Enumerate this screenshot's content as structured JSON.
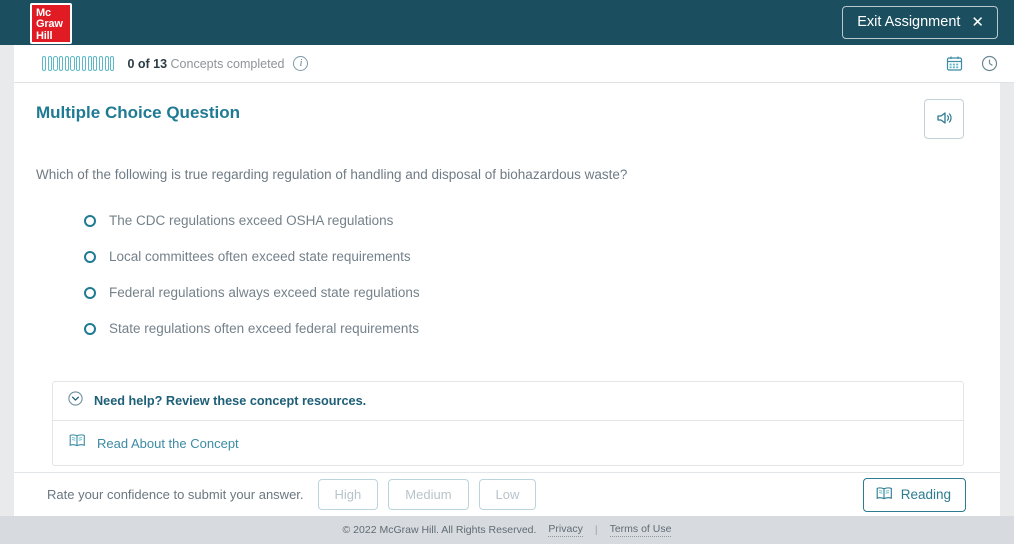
{
  "topbar": {
    "logo_lines": [
      "Mc",
      "Graw",
      "Hill"
    ],
    "exit_label": "Exit Assignment",
    "exit_x": "✕"
  },
  "progress": {
    "bars_total": 13,
    "bars_filled": 0,
    "count_text": "0 of 13",
    "label": "Concepts completed",
    "info_glyph": "i",
    "calendar_icon": "calendar-icon",
    "clock_icon": "clock-icon"
  },
  "question": {
    "title": "Multiple Choice Question",
    "prompt": "Which of the following is true regarding regulation of handling and disposal of biohazardous waste?",
    "speaker_icon": "speaker-icon",
    "options": [
      {
        "label": "The CDC regulations exceed OSHA regulations",
        "selected": false
      },
      {
        "label": "Local committees often exceed state requirements",
        "selected": false
      },
      {
        "label": "Federal regulations always exceed state regulations",
        "selected": false
      },
      {
        "label": "State regulations often exceed federal requirements",
        "selected": false
      }
    ]
  },
  "help": {
    "title": "Need help? Review these concept resources.",
    "chevron_icon": "chevron-down-icon",
    "resource_label": "Read About the Concept",
    "book_icon": "book-icon"
  },
  "confidence": {
    "prompt": "Rate your confidence to submit your answer.",
    "buttons": [
      "High",
      "Medium",
      "Low"
    ],
    "reading_label": "Reading",
    "reading_icon": "book-icon"
  },
  "footer": {
    "copyright": "© 2022 McGraw Hill. All Rights Reserved.",
    "privacy": "Privacy",
    "separator": "|",
    "terms": "Terms of Use"
  },
  "colors": {
    "header_teal": "#1b4f60",
    "accent_teal": "#1f7a93",
    "logo_red": "#e01b24",
    "progress_bar": "#5bb8c8",
    "footer_bg": "#d7dbdf"
  }
}
